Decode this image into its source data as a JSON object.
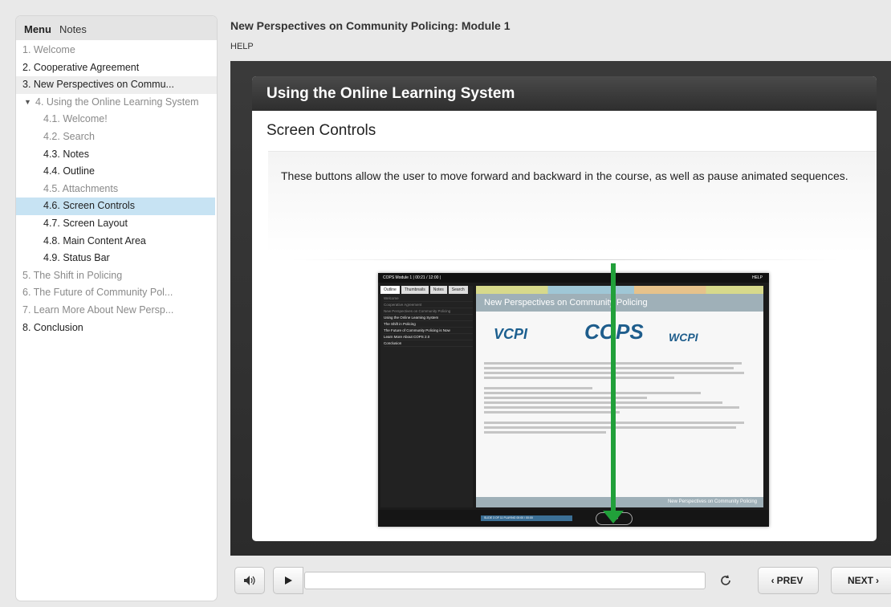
{
  "sidebar": {
    "tabs": [
      {
        "label": "Menu"
      },
      {
        "label": "Notes"
      }
    ],
    "items": [
      {
        "label": "1. Welcome"
      },
      {
        "label": "2. Cooperative Agreement"
      },
      {
        "label": "3. New Perspectives on Commu..."
      },
      {
        "label": "4. Using the Online Learning System"
      },
      {
        "label": "4.1. Welcome!"
      },
      {
        "label": "4.2. Search"
      },
      {
        "label": "4.3. Notes"
      },
      {
        "label": "4.4. Outline"
      },
      {
        "label": "4.5. Attachments"
      },
      {
        "label": "4.6. Screen Controls"
      },
      {
        "label": "4.7. Screen Layout"
      },
      {
        "label": "4.8. Main Content Area"
      },
      {
        "label": "4.9. Status Bar"
      },
      {
        "label": "5. The Shift in Policing"
      },
      {
        "label": "6. The Future of Community Pol..."
      },
      {
        "label": "7. Learn More About New Persp..."
      },
      {
        "label": "8. Conclusion"
      }
    ]
  },
  "header": {
    "title": "New Perspectives on Community Policing: Module 1",
    "help": "HELP"
  },
  "slide": {
    "title": "Using the Online Learning System",
    "subtitle": "Screen Controls",
    "body": "These buttons allow the user to move forward and backward in the course, as well as pause animated sequences."
  },
  "screenshot": {
    "top_title": "COPS Module 1   |  00:21 / 12:00  |",
    "top_help": "HELP",
    "tabs": [
      "Outline",
      "Thumbnails",
      "Notes",
      "Search"
    ],
    "list": [
      "Welcome",
      "Cooperative Agreement",
      "New Perspectives on Community Policing",
      "Using the Online Learning System",
      "The Shift in Policing",
      "The Future of Community Policing is Now",
      "Learn More About COPS 2.0",
      "Conclusion"
    ],
    "heading": "New Perspectives on Community Policing",
    "logo_vcpi": "VCPI",
    "logo_cops": "COPS",
    "logo_wcpi": "WCPI",
    "footer": "New Perspectives on Community Policing",
    "status": "SLIDE 3 OF 11    PLAYING    00:00 / 00:00",
    "pill": "II  ◂ ▸"
  },
  "controls": {
    "prev_label": "PREV",
    "next_label": "NEXT"
  },
  "icons": {
    "volume": "speaker-icon",
    "play": "play-icon",
    "replay": "replay-icon",
    "prev": "chevron-left-icon",
    "next": "chevron-right-icon",
    "expand": "caret-down-icon"
  },
  "colors": {
    "selected_row": "#c7e3f3",
    "slide_bar": "#3a3a3a",
    "arrow": "#21a03a"
  }
}
